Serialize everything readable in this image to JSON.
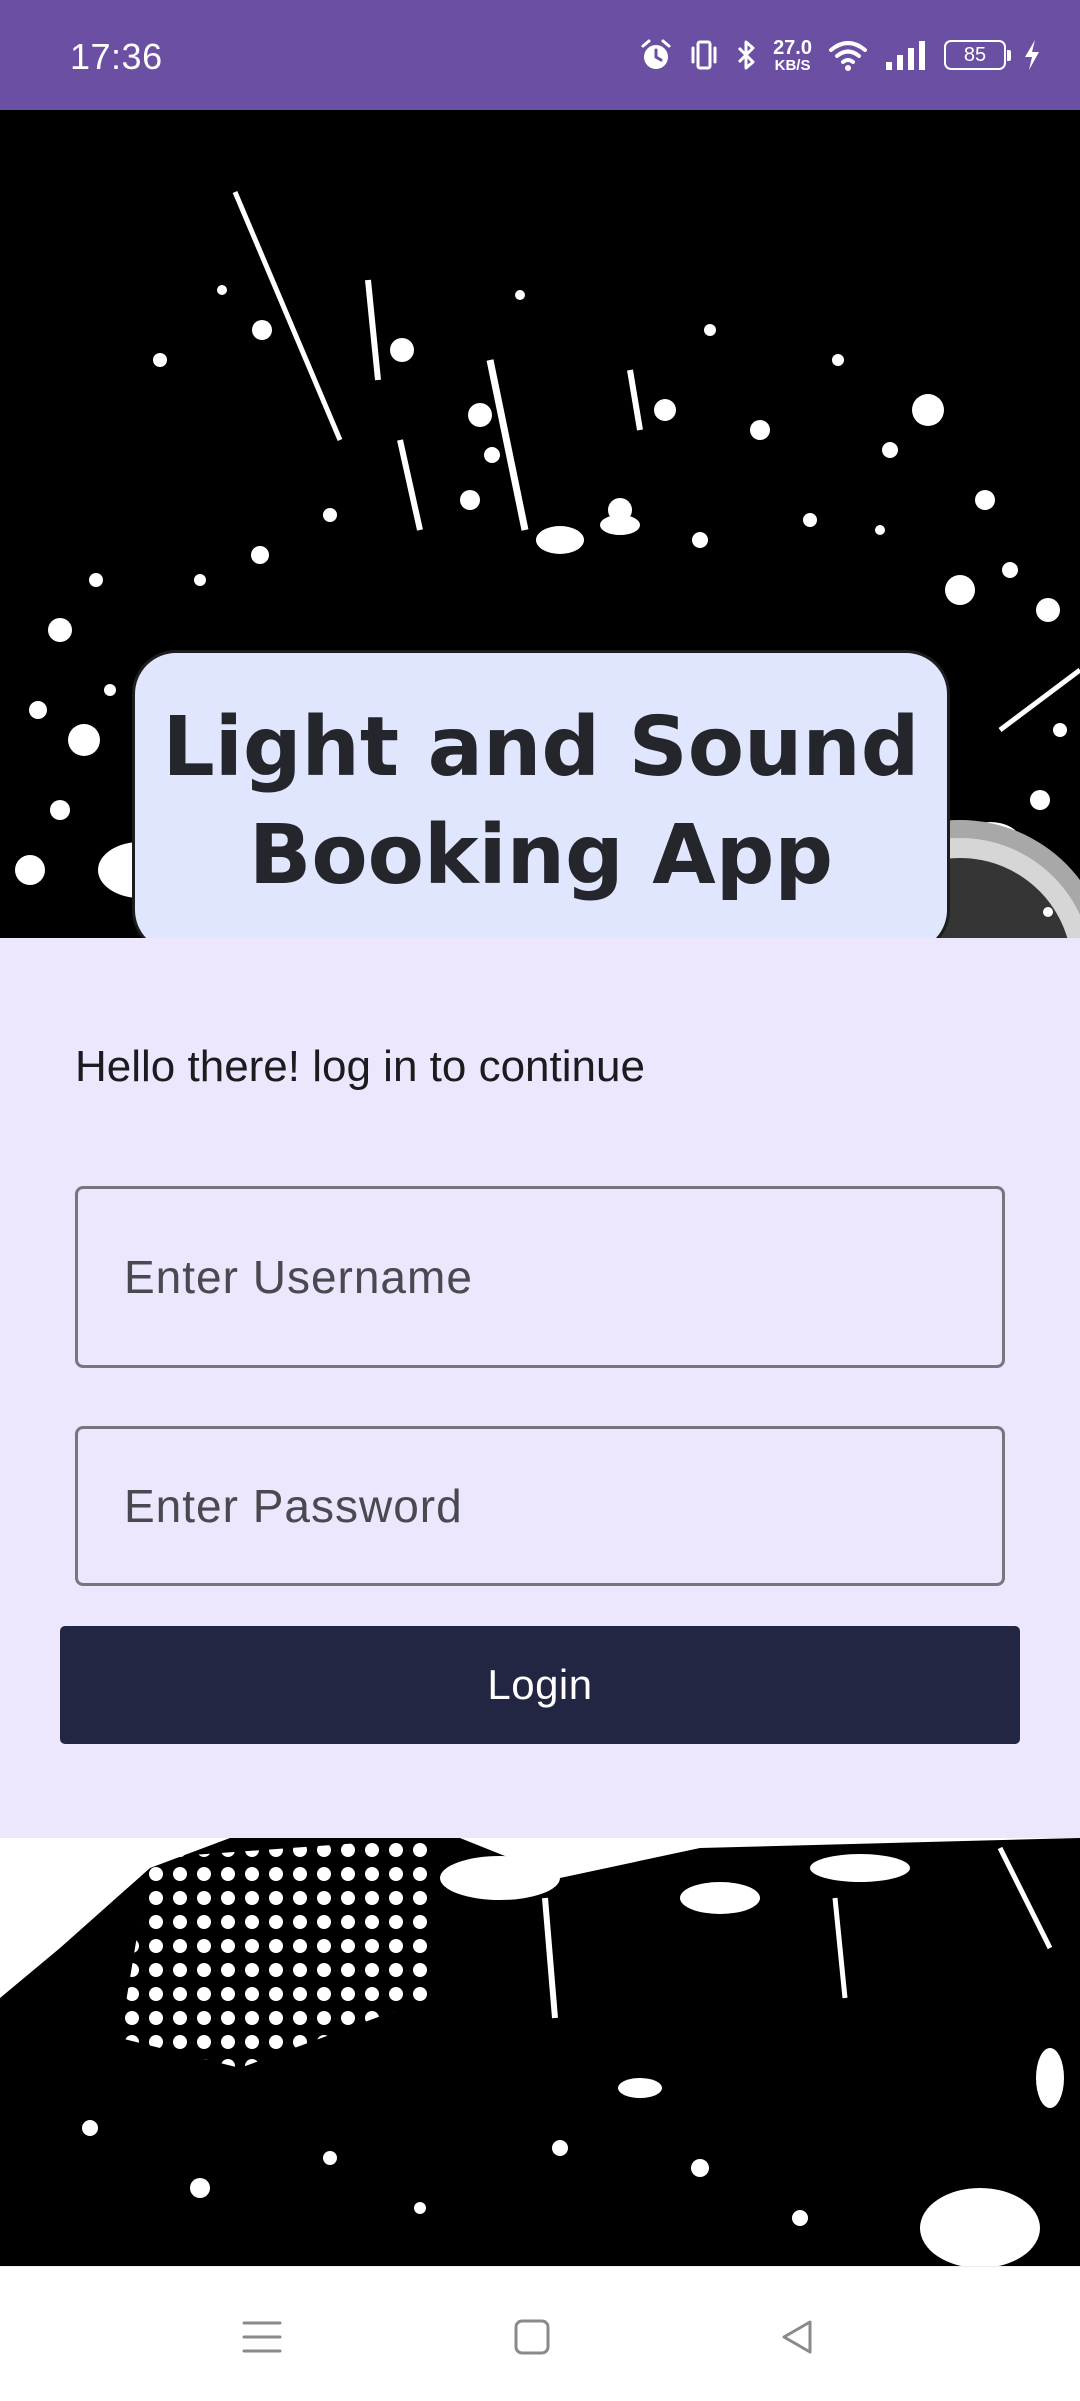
{
  "status_bar": {
    "time": "17:36",
    "net_speed_value": "27.0",
    "net_speed_unit": "KB/S",
    "battery_level": "85",
    "icons": [
      "alarm-icon",
      "vibrate-icon",
      "bluetooth-icon",
      "wifi-icon",
      "signal-icon",
      "battery-icon",
      "charging-icon"
    ]
  },
  "hero": {
    "title": "Light and Sound\nBooking App"
  },
  "login_form": {
    "prompt": "Hello there! log in to continue",
    "username_placeholder": "Enter Username",
    "password_placeholder": "Enter Password",
    "login_label": "Login"
  },
  "nav_bar": {
    "buttons": [
      "menu",
      "home",
      "back"
    ]
  },
  "colors": {
    "status_bar": "#6a4fa3",
    "title_card": "#dfe6fd",
    "form_background": "#ece7fc",
    "login_button": "#222642",
    "text": "#1c1b1f"
  }
}
